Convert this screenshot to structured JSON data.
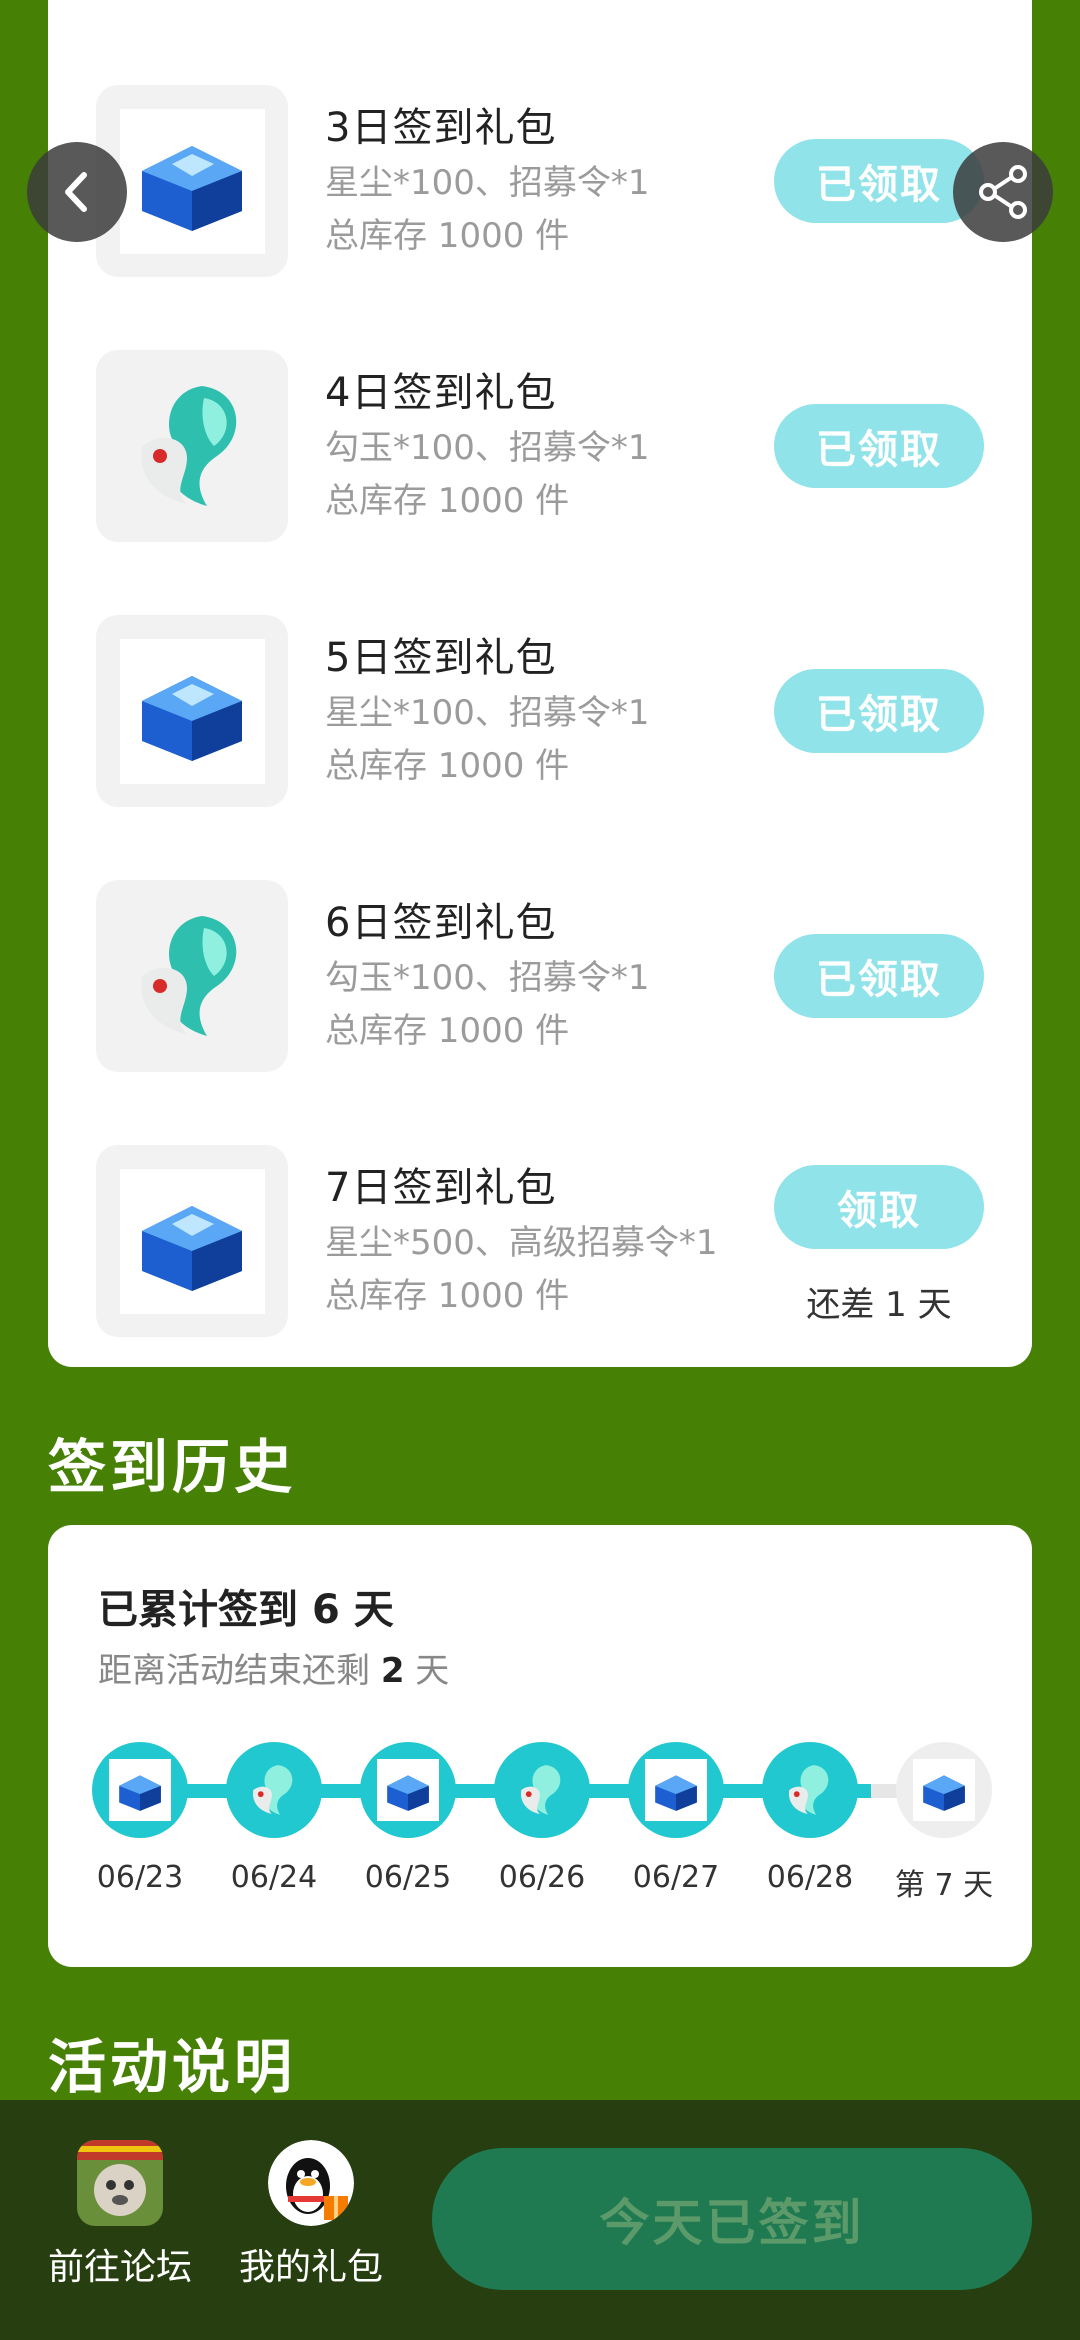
{
  "gifts": [
    {
      "title": "3日签到礼包",
      "desc": "星尘*100、招募令*1",
      "stock": "总库存 1000 件",
      "button": "已领取",
      "icon": "blue-chest-icon"
    },
    {
      "title": "4日签到礼包",
      "desc": "勾玉*100、招募令*1",
      "stock": "总库存 1000 件",
      "button": "已领取",
      "icon": "jade-magatama-icon"
    },
    {
      "title": "5日签到礼包",
      "desc": "星尘*100、招募令*1",
      "stock": "总库存 1000 件",
      "button": "已领取",
      "icon": "blue-chest-icon"
    },
    {
      "title": "6日签到礼包",
      "desc": "勾玉*100、招募令*1",
      "stock": "总库存 1000 件",
      "button": "已领取",
      "icon": "jade-magatama-icon"
    },
    {
      "title": "7日签到礼包",
      "desc": "星尘*500、高级招募令*1",
      "stock": "总库存 1000 件",
      "button": "领取",
      "remain": "还差 1 天",
      "icon": "blue-chest-icon"
    }
  ],
  "history": {
    "section_title": "签到历史",
    "total_prefix": "已累计签到",
    "total_days": "6",
    "total_suffix": "天",
    "remain_prefix": "距离活动结束还剩",
    "remain_days": "2",
    "remain_suffix": "天",
    "days": [
      {
        "label": "06/23",
        "icon": "blue-chest-icon",
        "done": true
      },
      {
        "label": "06/24",
        "icon": "jade-magatama-icon",
        "done": true
      },
      {
        "label": "06/25",
        "icon": "blue-chest-icon",
        "done": true
      },
      {
        "label": "06/26",
        "icon": "jade-magatama-icon",
        "done": true
      },
      {
        "label": "06/27",
        "icon": "blue-chest-icon",
        "done": true
      },
      {
        "label": "06/28",
        "icon": "jade-magatama-icon",
        "done": true
      },
      {
        "label": "第 7 天",
        "icon": "blue-chest-icon",
        "done": false
      }
    ]
  },
  "rules": {
    "section_title": "活动说明"
  },
  "bottom": {
    "forum_label": "前往论坛",
    "gift_label": "我的礼包",
    "checkin_label": "今天已签到"
  },
  "colors": {
    "page_bg": "#468005",
    "accent": "#21c8cf",
    "claim_btn": "#8fe3e9",
    "bottom_bar": "#273f10",
    "checkin_btn": "#1f7a52"
  },
  "icons": {
    "back": "chevron-left-icon",
    "share": "share-icon"
  }
}
